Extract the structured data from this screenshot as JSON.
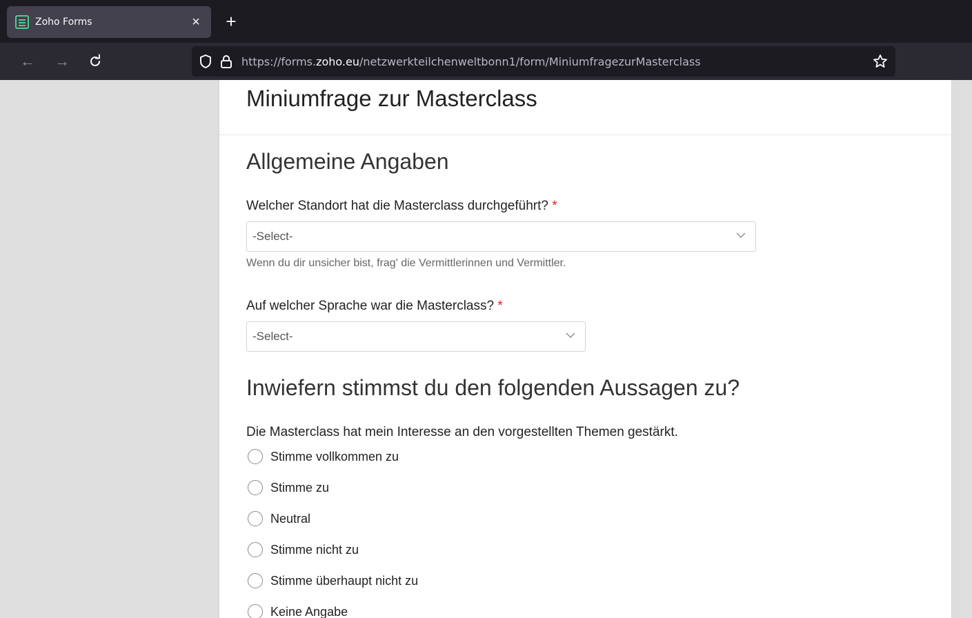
{
  "browser": {
    "tab_title": "Zoho Forms",
    "tab_close": "×",
    "new_tab": "+",
    "url_prefix": "https://forms.",
    "url_domain": "zoho.eu",
    "url_path": "/netzwerkteilchenweltbonn1/form/MiniumfragezurMasterclass"
  },
  "form": {
    "title": "Miniumfrage zur Masterclass",
    "section1_title": "Allgemeine Angaben",
    "q1": {
      "label": "Welcher Standort hat die Masterclass durchgeführt?",
      "required": "*",
      "selected": "-Select-",
      "hint": "Wenn du dir unsicher bist, frag' die Vermittlerinnen und Vermittler."
    },
    "q2": {
      "label": "Auf welcher Sprache war die Masterclass?",
      "required": "*",
      "selected": "-Select-"
    },
    "section2_title": "Inwiefern stimmst du den folgenden Aussagen zu?",
    "q3": {
      "label": "Die Masterclass hat mein Interesse an den vorgestellten Themen gestärkt.",
      "options": [
        "Stimme vollkommen zu",
        "Stimme zu",
        "Neutral",
        "Stimme nicht zu",
        "Stimme überhaupt nicht zu",
        "Keine Angabe"
      ]
    }
  },
  "colors": {
    "tabbar": "#1c1b22",
    "navbar": "#2b2a33",
    "required_star": "#e0211f",
    "favicon": "#54c98e"
  }
}
